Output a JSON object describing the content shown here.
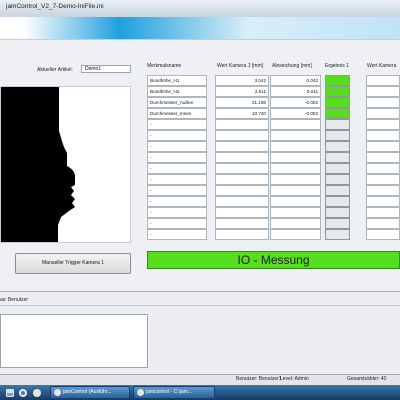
{
  "window": {
    "title": "jamControl_V2_7-Demo-IniFile.ini"
  },
  "colors": {
    "ok_green": "#55dd1e",
    "taskbar_blue": "#1e4f86",
    "menu_gradient_blue": "#1fa0dd"
  },
  "header": {
    "article_label": "Aktueller Artikel:",
    "article_value": "Demo1"
  },
  "camera": {
    "trigger_button": "Manueller Trigger Kamera 1"
  },
  "table": {
    "columns": [
      "Merkmalsname",
      "Wert Kamera 1 [mm]",
      "Abweichung [mm]",
      "Ergebnis 1",
      "Wert Kamera"
    ],
    "rows": [
      {
        "name": "Bundhöhe_H1",
        "value": "3.042",
        "deviation": "0.042",
        "result": "ok"
      },
      {
        "name": "Bundhöhe_H2",
        "value": "2.511",
        "deviation": "0.011",
        "result": "ok"
      },
      {
        "name": "Durchmesser_Außen",
        "value": "21.198",
        "deviation": "-0.002",
        "result": "ok"
      },
      {
        "name": "Durchmesser_Innen",
        "value": "10.740",
        "deviation": "-0.002",
        "result": "ok"
      },
      {
        "name": "-",
        "value": "",
        "deviation": "",
        "result": ""
      },
      {
        "name": "-",
        "value": "",
        "deviation": "",
        "result": ""
      },
      {
        "name": "-",
        "value": "",
        "deviation": "",
        "result": ""
      },
      {
        "name": "-",
        "value": "",
        "deviation": "",
        "result": ""
      },
      {
        "name": "-",
        "value": "",
        "deviation": "",
        "result": ""
      },
      {
        "name": "-",
        "value": "",
        "deviation": "",
        "result": ""
      },
      {
        "name": "-",
        "value": "",
        "deviation": "",
        "result": ""
      },
      {
        "name": "-",
        "value": "",
        "deviation": "",
        "result": ""
      },
      {
        "name": "-",
        "value": "",
        "deviation": "",
        "result": ""
      },
      {
        "name": "-",
        "value": "",
        "deviation": "",
        "result": ""
      },
      {
        "name": "-",
        "value": "",
        "deviation": "",
        "result": ""
      }
    ]
  },
  "status_banner": "IO - Messung",
  "log": {
    "header": "as: Benutzer"
  },
  "statusbar": {
    "user": "Benutzer: Benutzer1",
    "level": "Level: Admin",
    "counter": "Gesamtzähler: 40"
  },
  "taskbar": {
    "items": [
      "jamControl (Ausführ...",
      "jamcontrol - C:\\jam..."
    ]
  }
}
